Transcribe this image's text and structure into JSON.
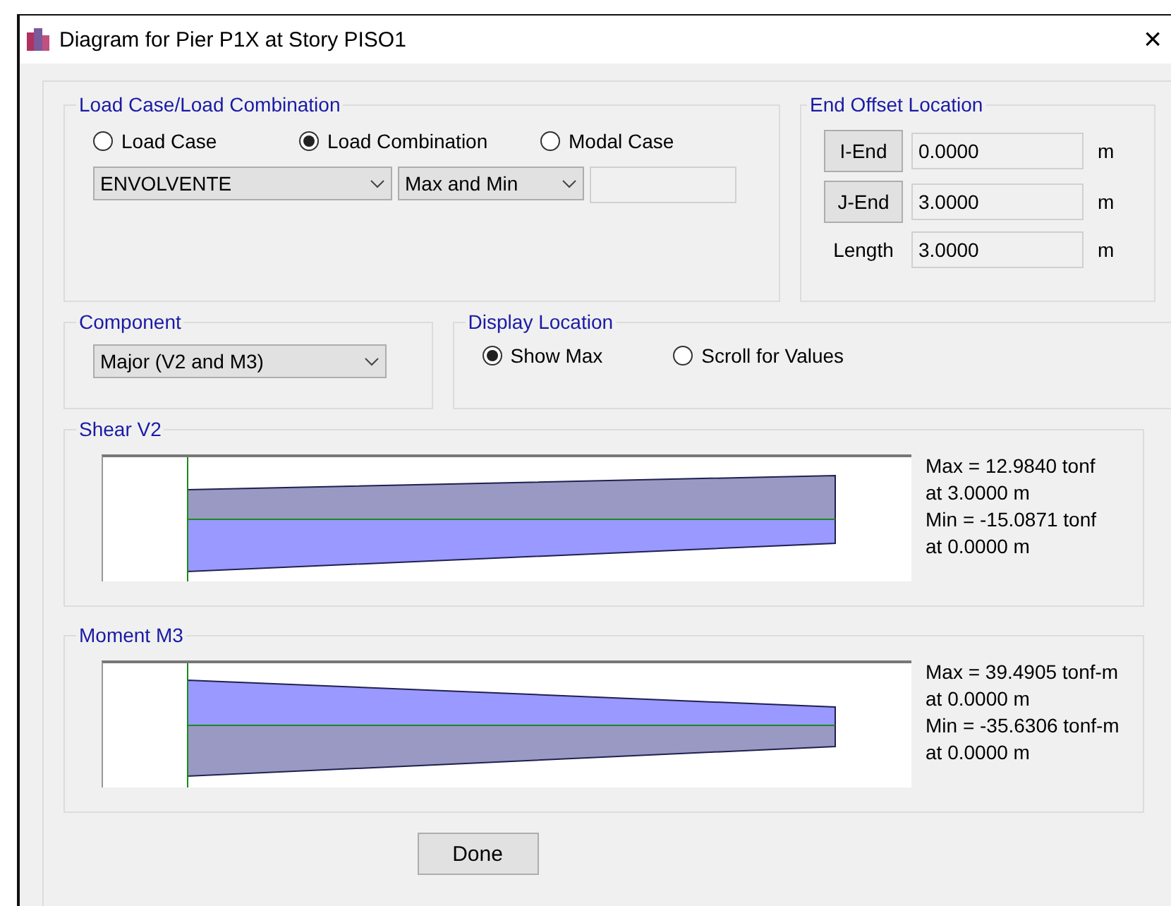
{
  "window": {
    "title": "Diagram for Pier P1X at Story PISO1",
    "close": "×"
  },
  "load_case_group": {
    "title": "Load Case/Load Combination",
    "options": [
      {
        "label": "Load Case",
        "selected": false
      },
      {
        "label": "Load Combination",
        "selected": true
      },
      {
        "label": "Modal Case",
        "selected": false
      }
    ],
    "combination": "ENVOLVENTE",
    "type": "Max and Min"
  },
  "end_offset": {
    "title": "End Offset Location",
    "rows": [
      {
        "kind": "button",
        "label": "I-End",
        "value": "0.0000",
        "unit": "m"
      },
      {
        "kind": "button",
        "label": "J-End",
        "value": "3.0000",
        "unit": "m"
      },
      {
        "kind": "label",
        "label": "Length",
        "value": "3.0000",
        "unit": "m"
      }
    ]
  },
  "component": {
    "title": "Component",
    "value": "Major (V2 and M3)"
  },
  "display_location": {
    "title": "Display Location",
    "options": [
      {
        "label": "Show Max",
        "selected": true
      },
      {
        "label": "Scroll for Values",
        "selected": false
      }
    ]
  },
  "diagrams": [
    {
      "title": "Shear V2",
      "kind": "shear",
      "lines": [
        "Max = 12.9840 tonf",
        "at 3.0000 m",
        "Min = -15.0871 tonf",
        "at 0.0000 m"
      ]
    },
    {
      "title": "Moment M3",
      "kind": "moment",
      "lines": [
        "Max = 39.4905 tonf-m",
        "at 0.0000 m",
        "Min = -35.6306 tonf-m",
        "at 0.0000 m"
      ]
    }
  ],
  "buttons": [
    "Done"
  ]
}
